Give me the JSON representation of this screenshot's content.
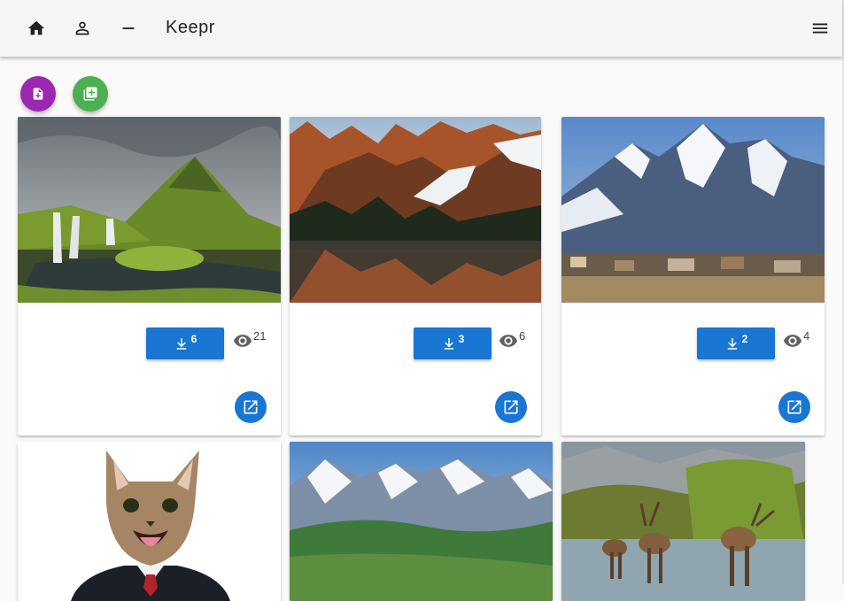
{
  "app": {
    "title": "Keepr"
  },
  "nav": {
    "home_icon": "home-icon",
    "profile_icon": "account-icon",
    "minus_icon": "minus-icon",
    "menu_icon": "menu-icon"
  },
  "actions": {
    "new_keep_color": "#9c27b0",
    "new_vault_color": "#4caf50"
  },
  "colors": {
    "primary": "#1976d2"
  },
  "keeps": [
    {
      "image": "waterfall-mountain",
      "keeps": "6",
      "views": "21"
    },
    {
      "image": "alpine-lake-reflection",
      "keeps": "3",
      "views": "6"
    },
    {
      "image": "snowy-peaks-town",
      "keeps": "2",
      "views": "4"
    },
    {
      "image": "cat-in-suit"
    },
    {
      "image": "snowy-range-valley"
    },
    {
      "image": "elk-in-river"
    }
  ]
}
